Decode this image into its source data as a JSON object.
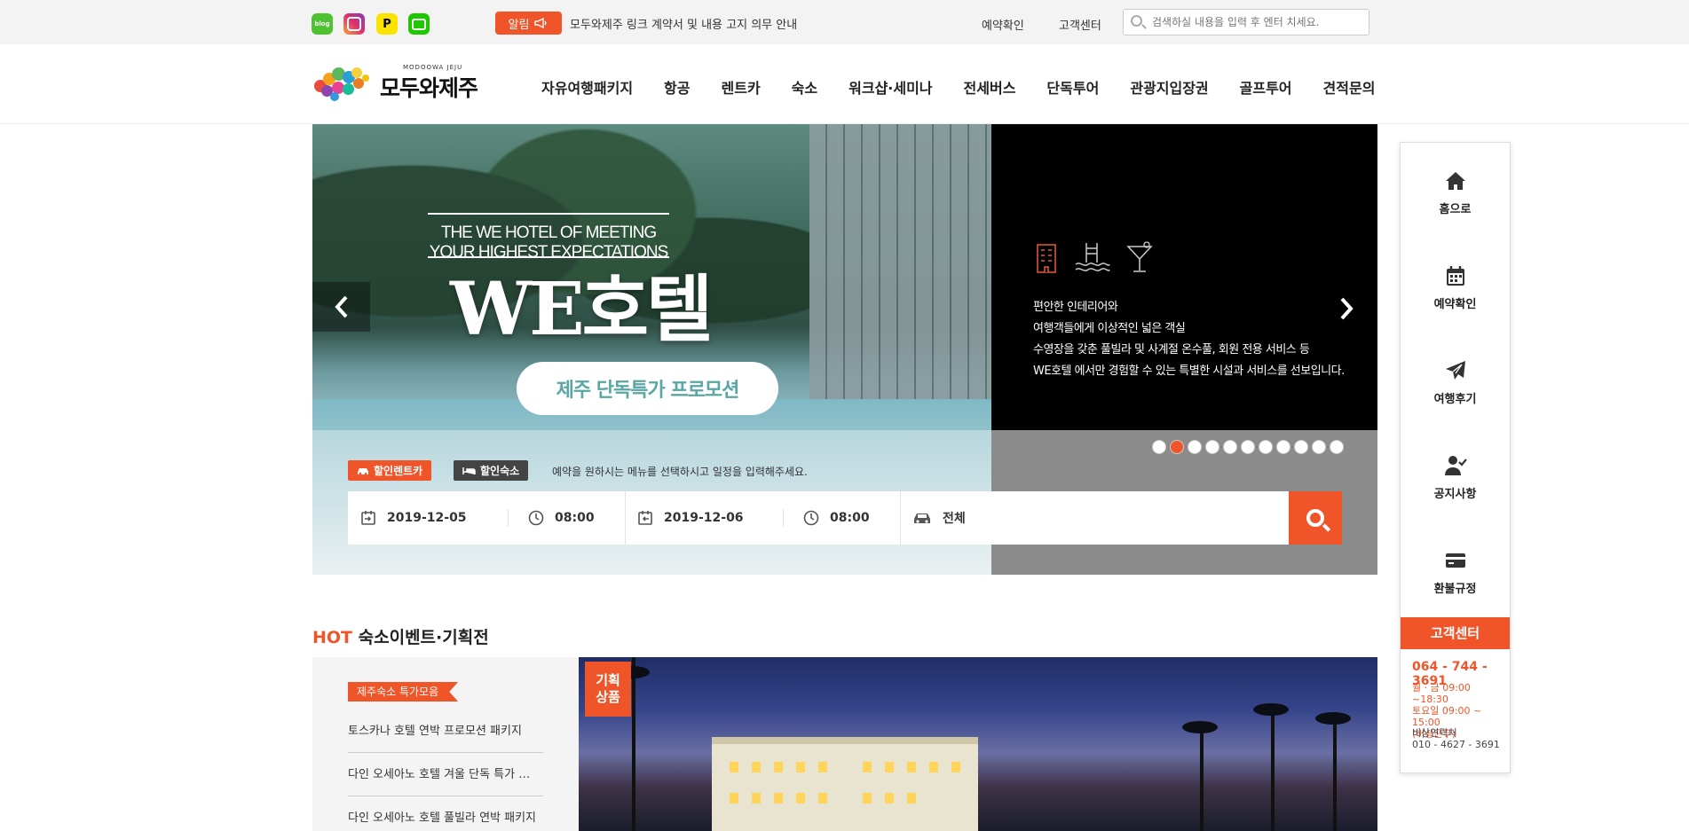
{
  "topbar": {
    "sns": [
      {
        "name": "blog",
        "label": "blog"
      },
      {
        "name": "instagram",
        "label": ""
      },
      {
        "name": "kakaopay",
        "label": "P"
      },
      {
        "name": "kakaotalk",
        "label": ""
      }
    ],
    "notice_label": "알림",
    "notice_text": "모두와제주 링크 계약서 및 내용 고지 의무 안내",
    "links": [
      "예약확인",
      "고객센터"
    ],
    "search_placeholder": "검색하실 내용을 입력 후 엔터 치세요."
  },
  "header": {
    "logo_sub": "MODOOWA JEJU",
    "logo_name": "모두와제주",
    "nav": [
      "자유여행패키지",
      "항공",
      "렌트카",
      "숙소",
      "워크샵·세미나",
      "전세버스",
      "단독투어",
      "관광지입장권",
      "골프투어",
      "견적문의"
    ]
  },
  "hero": {
    "subtitle": "THE WE HOTEL OF MEETING YOUR HIGHEST EXPECTATIONS",
    "title": "WE호텔",
    "pill": "제주 단독특가 프로모션",
    "features": [
      "편안한 인테리어와",
      "여행객들에게 이상적인 넓은 객실",
      "수영장을 갖춘 풀빌라 및 사계절 온수풀, 회원 전용 서비스 등",
      "WE호텔 에서만 경험할 수 있는 특별한 시설과 서비스를 선보입니다."
    ],
    "slide_count": 11,
    "active_slide": 2
  },
  "booking": {
    "tabs": [
      {
        "label": "할인렌트카",
        "icon": "car-icon"
      },
      {
        "label": "할인숙소",
        "icon": "bed-icon"
      }
    ],
    "guide": "예약을 원하시는 메뉴를 선택하시고 일정을 입력해주세요.",
    "pickup_date": "2019-12-05",
    "pickup_time": "08:00",
    "return_date": "2019-12-06",
    "return_time": "08:00",
    "car_type": "전체"
  },
  "quick": {
    "items": [
      {
        "label": "홈으로",
        "icon": "home-icon"
      },
      {
        "label": "예약확인",
        "icon": "calendar-icon"
      },
      {
        "label": "여행후기",
        "icon": "paper-plane-icon"
      },
      {
        "label": "공지사항",
        "icon": "user-check-icon"
      },
      {
        "label": "환불규정",
        "icon": "card-icon"
      }
    ],
    "cs_title": "고객센터",
    "cs_phone": "064 - 744 - 3691",
    "cs_hours_1": "월 · 금 09:00 ~18:30",
    "cs_hours_2": "토요일 09:00 ~ 15:00",
    "cs_hours_3": "(비상근무)",
    "cs_emergency_label": "비상연락처",
    "cs_emergency_phone": "010 - 4627 - 3691"
  },
  "hot": {
    "title_accent": "HOT",
    "title_rest": "숙소이벤트·기획전",
    "ribbon": "제주숙소 특가모음",
    "items": [
      "토스카나 호텔 연박 프로모션 패키지",
      "다인 오세아노 호텔 겨울 단독 특가 …",
      "다인 오세아노 호텔 풀빌라 연박 패키지"
    ],
    "badge_1": "기획",
    "badge_2": "상품"
  },
  "colors": {
    "accent": "#f0552a",
    "dark": "#000000"
  }
}
